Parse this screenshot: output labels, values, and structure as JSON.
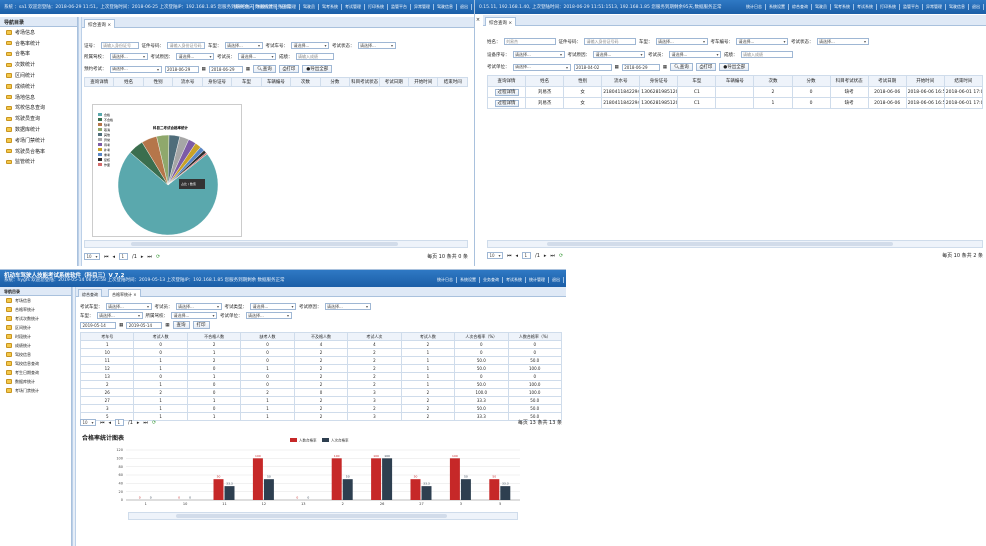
{
  "p1": {
    "header": "系统  ：sa1  欢迎您登陆：2018-06-29 11:51，上次登陆时间：2018-06-25 上次登陆IP：192.168.1.85 您服务到期剩余天   数据统计服务正常",
    "menu": [
      "统计日志",
      "系统设置",
      "绩效管理",
      "驾驶员",
      "驾考系统",
      "考试管理",
      "打印系统",
      "监管平台",
      "异常管理",
      "驾驶信息",
      "退出"
    ],
    "nav_title": "导航目录",
    "nav": [
      "考场信息",
      "合格率统计",
      "合格率",
      "次数统计",
      "区间统计",
      "成绩统计",
      "场地信息",
      "驾校信息查询",
      "驾驶员查询",
      "数据库统计",
      "考场门禁统计",
      "驾驶员合格率",
      "监管统计"
    ],
    "tab": "综合查询",
    "row1": [
      "证号：",
      "请输入身份证号",
      "证件号码：",
      "请输入身份证号码",
      "车型：",
      "请选择...",
      "考试车号：",
      "请选择...",
      "考试状态：",
      "请选择..."
    ],
    "row2": [
      "所属驾校：",
      "请选择...",
      "考试原因：",
      "请选择...",
      "考试员：",
      "请选择...",
      "成绩：",
      "请输入成绩"
    ],
    "row3": [
      "预约考试：",
      "请选择...",
      "2018-06-29",
      "2018-06-29",
      "查询",
      "打印",
      "导出全部"
    ],
    "cols": [
      "查询详情",
      "姓名",
      "性别",
      "流水号",
      "身份证号",
      "车型",
      "车辆编号",
      "次数",
      "分数",
      "科目考试状态",
      "考试日期",
      "开始时间",
      "结束时间"
    ],
    "pie_title": "科目二考试合格率统计",
    "pie_tip": "占比 / 数值",
    "legend": [
      "合格",
      "不合格",
      "缺考",
      "取消",
      "其他",
      "异常",
      "待考",
      "补考",
      "重考",
      "复核",
      "作废"
    ],
    "pager": {
      "size": "10",
      "page": "1",
      "of": "/1",
      "info": "每页 10 条共 0 条"
    }
  },
  "p2": {
    "header": "0.15.11, 192.168.1.40, 上次登陆时间：2018-06-29 11:51:1513, 192.168.1.85 您服务到期剩余95天,数据服务正常",
    "menu": [
      "统计日志",
      "系统设置",
      "综合查询",
      "驾驶员",
      "驾考系统",
      "考试系统",
      "打印系统",
      "监管平台",
      "异常管理",
      "驾驶信息",
      "退出"
    ],
    "tab": "综合查询",
    "f1": [
      "姓名：",
      "刘易杰",
      "证件号码：",
      "请输入身份证号码",
      "车型：",
      "请选择...",
      "考车编号：",
      "请选择...",
      "考试状态：",
      "请选择..."
    ],
    "f2": [
      "设备序号：",
      "请选择...",
      "考试原因：",
      "请选择...",
      "考试员：",
      "请选择...",
      "成绩：",
      "请输入成绩"
    ],
    "f3": [
      "考试单位：",
      "请选择...",
      "2018-04-02",
      "2018-06-29",
      "查询",
      "打印",
      "导出全部"
    ],
    "cols": [
      "查询详情",
      "姓名",
      "性别",
      "流水号",
      "身份证号",
      "车型",
      "车辆编号",
      "次数",
      "分数",
      "科目考试状态",
      "考试日期",
      "开始时间",
      "结束时间"
    ],
    "rows": [
      [
        "过程详情",
        "刘易杰",
        "女",
        "2180411842294",
        "130628198512057547",
        "C1",
        "",
        "2",
        "0",
        "缺考",
        "2018-06-06",
        "2018-06-06 16:57:01",
        "2018-06-01 17:07:5"
      ],
      [
        "过程详情",
        "刘易杰",
        "女",
        "2180411842294",
        "130628198512057547",
        "C1",
        "",
        "1",
        "0",
        "缺考",
        "2018-06-06",
        "2018-06-06 16:57:48",
        "2018-06-01 17:07:4"
      ]
    ],
    "pager": {
      "size": "10",
      "page": "1",
      "of": "/1",
      "info": "每页 10 条共 2 条"
    }
  },
  "p3": {
    "title": "机动车驾驶人技能考试系统软件（科目三）V 7.2",
    "header": "系统：hygfs  欢迎您登陆：2019-05-14 08:23:58  上次登陆时间：2019-05-13  上次登陆IP：192.168.1.85 您服务到期剩余  数据服务正常",
    "menu": [
      "统计日志",
      "系统设置",
      "业务查询",
      "考试系统",
      "统计管理",
      "退出"
    ],
    "nav_title": "导航目录",
    "nav": [
      "考场信息",
      "合格率统计",
      "考试次数统计",
      "区间统计",
      "时段统计",
      "成绩统计",
      "驾校信息",
      "驾校信息查询",
      "考生日期查询",
      "数据库统计",
      "考场门禁统计"
    ],
    "tabs": [
      "综合查询",
      "合格率统计"
    ],
    "q1": [
      "考试车型：",
      "请选择...",
      "考试员：",
      "请选择...",
      "考试类型：",
      "请选择...",
      "考试原因：",
      "请选择..."
    ],
    "q2": [
      "车型：",
      "请选择...",
      "所属驾校：",
      "请选择...",
      "考试单位：",
      "请选择...",
      "2019-05-14",
      "2019-05-14",
      "查询",
      "打印"
    ],
    "cols": [
      "考车号",
      "考试人数",
      "不合格人数",
      "缺考人数",
      "不及格人数",
      "考试人次",
      "考试人数",
      "人次合格率（%）",
      "人数合格率（%）"
    ],
    "rows": [
      [
        "1",
        "0",
        "2",
        "0",
        "4",
        "4",
        "2",
        "0",
        "0"
      ],
      [
        "10",
        "0",
        "1",
        "0",
        "2",
        "2",
        "1",
        "0",
        "0"
      ],
      [
        "11",
        "1",
        "2",
        "0",
        "2",
        "2",
        "1",
        "50.0",
        "50.0"
      ],
      [
        "12",
        "1",
        "0",
        "1",
        "2",
        "2",
        "1",
        "50.0",
        "100.0"
      ],
      [
        "13",
        "0",
        "1",
        "0",
        "2",
        "2",
        "1",
        "0",
        "0"
      ],
      [
        "2",
        "1",
        "0",
        "0",
        "2",
        "2",
        "1",
        "50.0",
        "100.0"
      ],
      [
        "26",
        "2",
        "0",
        "2",
        "0",
        "3",
        "2",
        "100.0",
        "100.0"
      ],
      [
        "27",
        "1",
        "1",
        "1",
        "2",
        "3",
        "2",
        "33.3",
        "50.0"
      ],
      [
        "3",
        "1",
        "0",
        "1",
        "2",
        "2",
        "2",
        "50.0",
        "50.0"
      ],
      [
        "5",
        "1",
        "1",
        "1",
        "2",
        "3",
        "2",
        "33.3",
        "50.0"
      ]
    ],
    "pager": {
      "size": "10",
      "page": "1",
      "of": "/1",
      "info": "每页 13 条共 13 条"
    },
    "chart_title": "合格率统计图表"
  },
  "footer": "",
  "chart_data": {
    "type": "bar",
    "title": "合格率统计图表",
    "ylim": [
      0,
      120
    ],
    "yticks": [
      0,
      20,
      40,
      60,
      80,
      100,
      120
    ],
    "categories": [
      "1",
      "10",
      "11",
      "12",
      "13",
      "2",
      "26",
      "27",
      "3",
      "5"
    ],
    "series": [
      {
        "name": "人数合格率",
        "color": "#c62828",
        "values": [
          0,
          0,
          50.0,
          100.0,
          0,
          100.0,
          100.0,
          50.0,
          100.0,
          50.0
        ]
      },
      {
        "name": "人次合格率",
        "color": "#2e3f50",
        "values": [
          0,
          0,
          33.3,
          50.0,
          0,
          50.0,
          100.0,
          33.3,
          50.0,
          33.3
        ]
      }
    ]
  }
}
